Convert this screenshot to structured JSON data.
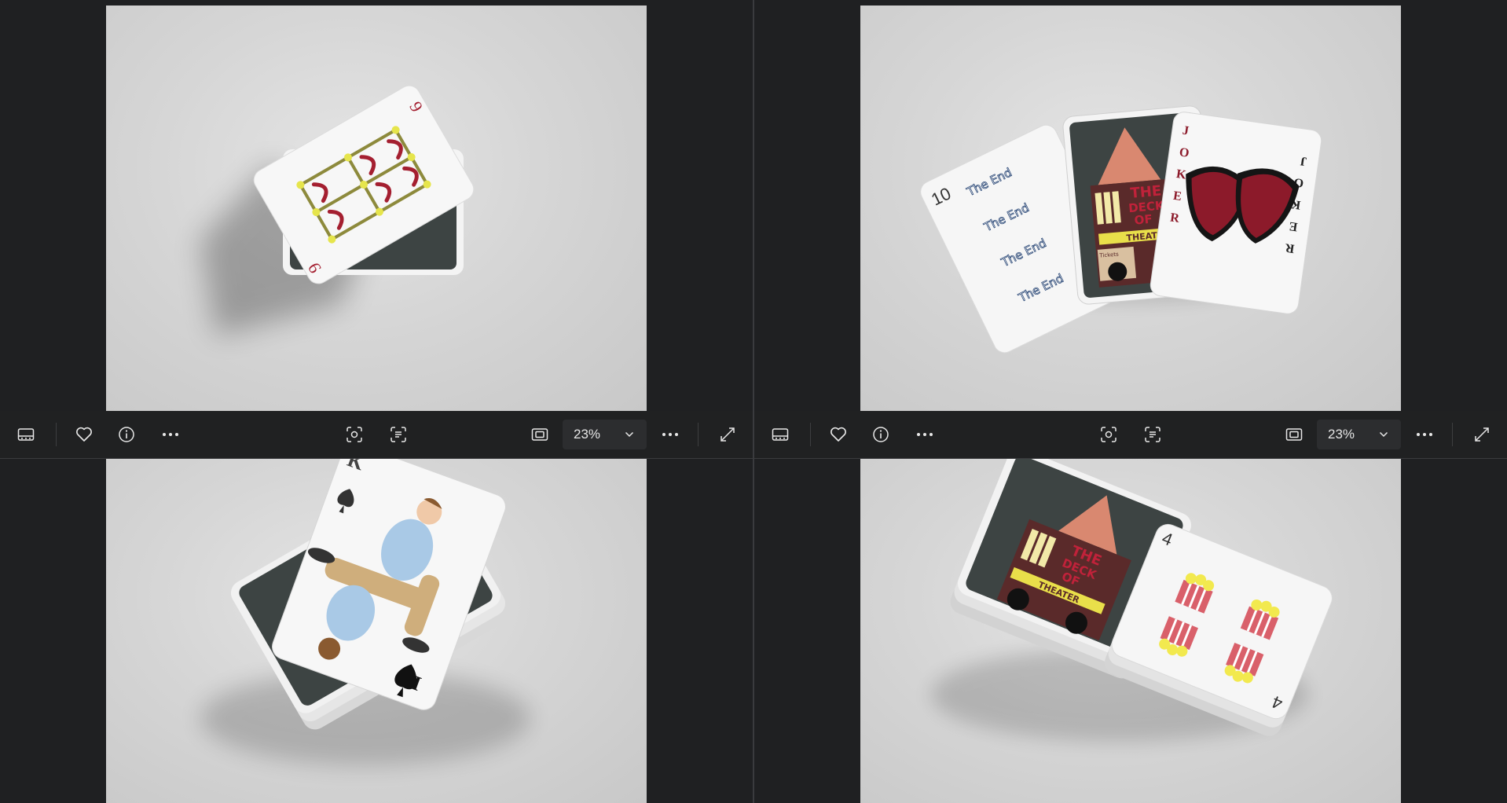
{
  "viewer": {
    "panes": [
      {
        "id": "top-left",
        "zoom": "23%",
        "photo": "nine-of-hearts-on-deck"
      },
      {
        "id": "top-right",
        "zoom": "23%",
        "photo": "fanned-cards-joker"
      },
      {
        "id": "bottom-left",
        "photo": "king-of-spades-on-deck"
      },
      {
        "id": "bottom-right",
        "photo": "two-decks-four-of-clubs"
      }
    ]
  },
  "cards": {
    "nine": {
      "rank": "9"
    },
    "ten": {
      "rank": "10",
      "text": "The End"
    },
    "back": {
      "title_lines": [
        "THE",
        "DECK",
        "OF"
      ],
      "subtitle": "THEATER",
      "tickets": "Tickets"
    },
    "joker": {
      "letters_left": [
        "J",
        "O",
        "K",
        "E",
        "R"
      ],
      "letters_right": [
        "J",
        "O",
        "K",
        "E",
        "R"
      ]
    },
    "king": {
      "rank": "K"
    },
    "four": {
      "rank": "4"
    }
  },
  "icons": [
    "filmstrip-icon",
    "heart-icon",
    "info-icon",
    "more-icon",
    "visual-search-icon",
    "text-scan-icon",
    "fit-icon",
    "chevron-down-icon",
    "expand-icon"
  ],
  "colors": {
    "background": "#1f2022",
    "toolbar": "#202122",
    "heart_red": "#9e1b2e",
    "popcorn_yellow": "#f2e94e"
  }
}
